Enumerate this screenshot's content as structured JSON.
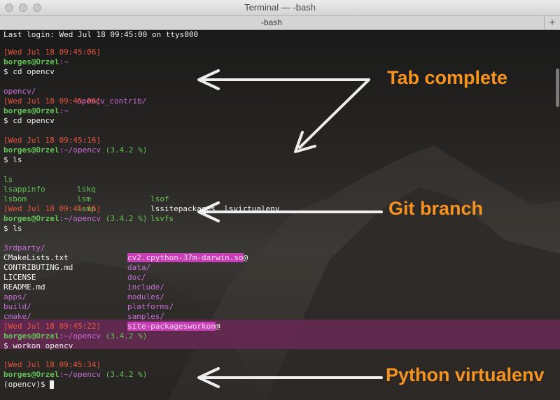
{
  "window": {
    "title": "Terminal — -bash",
    "tab": "-bash"
  },
  "lines": [
    {
      "text": "Last login: Wed Jul 18 09:45:00 on ttys000"
    },
    {
      "text": "[Wed Jul 18 09:45:06]"
    },
    {
      "user": "borges@Orzel",
      "path": ":~"
    },
    {
      "text": "$ cd opencv"
    },
    {
      "cols": [
        "opencv/",
        "opencv_contrib/"
      ]
    },
    {
      "text": "[Wed Jul 18 09:45:06]"
    },
    {
      "user": "borges@Orzel",
      "path": ":~"
    },
    {
      "text": "$ cd opencv"
    },
    {
      "text": "[Wed Jul 18 09:45:16]"
    },
    {
      "user": "borges@Orzel",
      "path": ":~/opencv",
      "branch": "(3.4.2 %)"
    },
    {
      "text": "$ ls"
    },
    {
      "cols": [
        "ls",
        "lskq",
        "lsof",
        "lsvirtualenv"
      ]
    },
    {
      "cols": [
        "lsappinfo",
        "lsm",
        "lssitepackages"
      ]
    },
    {
      "cols": [
        "lsbom",
        "lsmp",
        "lsvfs"
      ]
    },
    {
      "text": "[Wed Jul 18 09:45:16]"
    },
    {
      "user": "borges@Orzel",
      "path": ":~/opencv",
      "branch": "(3.4.2 %)"
    },
    {
      "text": "$ ls"
    },
    {
      "cols": [
        "3rdparty/",
        "cv2.cpython-37m-darwin.so",
        "@"
      ]
    },
    {
      "cols": [
        "CMakeLists.txt",
        "data/"
      ]
    },
    {
      "cols": [
        "CONTRIBUTING.md",
        "doc/"
      ]
    },
    {
      "cols": [
        "LICENSE",
        "include/"
      ]
    },
    {
      "cols": [
        "README.md",
        "modules/"
      ]
    },
    {
      "cols": [
        "apps/",
        "platforms/"
      ]
    },
    {
      "cols": [
        "build/",
        "samples/"
      ]
    },
    {
      "cols": [
        "cmake/",
        "site-packagesworkon",
        "@"
      ]
    },
    {
      "text": "[Wed Jul 18 09:45:22]"
    },
    {
      "user": "borges@Orzel",
      "path": ":~/opencv",
      "branch": "(3.4.2 %)"
    },
    {
      "text": "$ workon opencv"
    },
    {
      "text": "[Wed Jul 18 09:45:34]"
    },
    {
      "user": "borges@Orzel",
      "path": ":~/opencv",
      "branch": "(3.4.2 %)"
    },
    {
      "text": "(opencv)$"
    }
  ],
  "annotations": {
    "tab_complete": "Tab complete",
    "git_branch": "Git branch",
    "python_virtualenv": "Python virtualenv"
  },
  "colors": {
    "timestamp": "#e8553e",
    "user": "#63c254",
    "path": "#c56ed6",
    "branch": "#63c254",
    "highlight": "#c73fb5",
    "annotation": "#f59220"
  },
  "icons": [
    "close-button",
    "minimize-button",
    "zoom-button",
    "new-tab-plus-icon",
    "cursor-block"
  ]
}
